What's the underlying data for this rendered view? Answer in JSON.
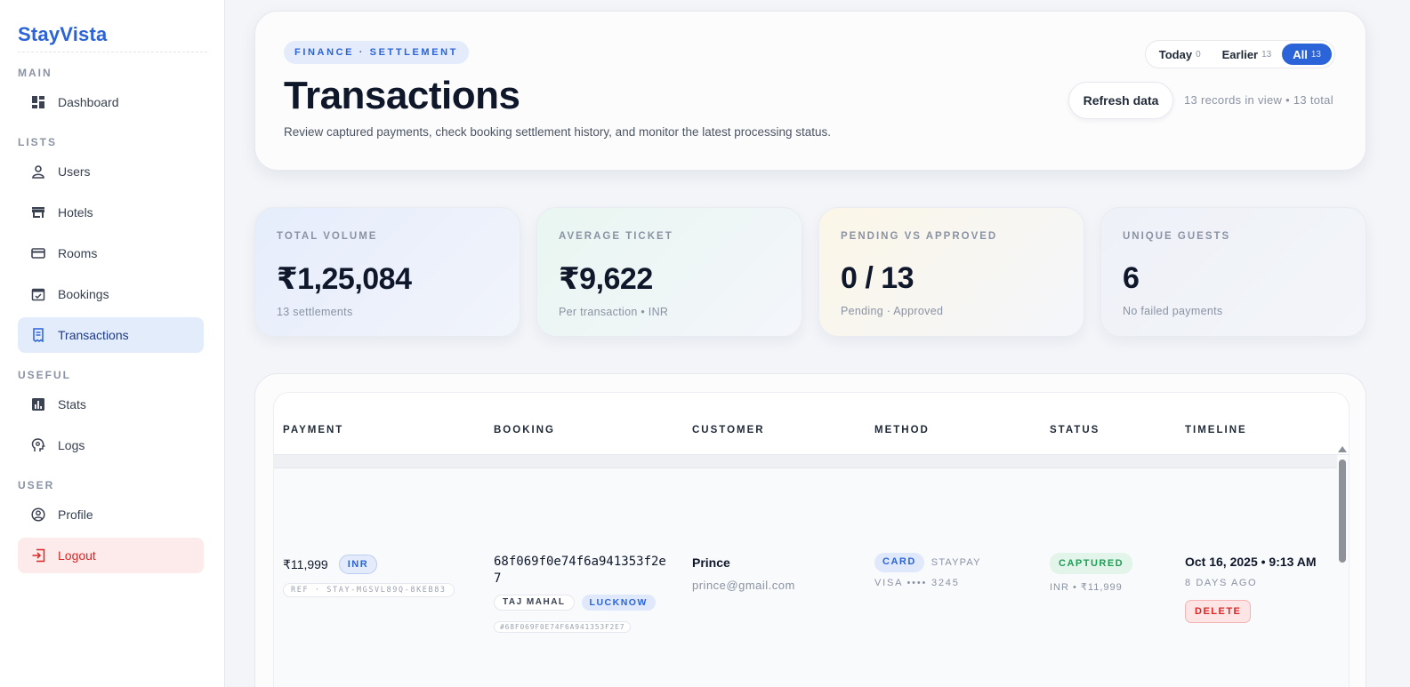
{
  "app": {
    "name": "StayVista"
  },
  "sidebar": {
    "sections": [
      {
        "title": "MAIN",
        "items": [
          {
            "label": "Dashboard",
            "icon": "dashboard-icon"
          }
        ]
      },
      {
        "title": "LISTS",
        "items": [
          {
            "label": "Users",
            "icon": "user-icon"
          },
          {
            "label": "Hotels",
            "icon": "store-icon"
          },
          {
            "label": "Rooms",
            "icon": "credit-card-icon"
          },
          {
            "label": "Bookings",
            "icon": "calendar-check-icon"
          },
          {
            "label": "Transactions",
            "icon": "receipt-icon",
            "active": true
          }
        ]
      },
      {
        "title": "USEFUL",
        "items": [
          {
            "label": "Stats",
            "icon": "bar-chart-icon"
          },
          {
            "label": "Logs",
            "icon": "psychology-icon"
          }
        ]
      },
      {
        "title": "USER",
        "items": [
          {
            "label": "Profile",
            "icon": "account-circle-icon"
          },
          {
            "label": "Logout",
            "icon": "logout-icon"
          }
        ]
      }
    ]
  },
  "header": {
    "eyebrow": "FINANCE · SETTLEMENT",
    "title": "Transactions",
    "subtitle": "Review captured payments, check booking settlement history, and monitor the latest processing status.",
    "filters": [
      {
        "label": "Today",
        "count": "0"
      },
      {
        "label": "Earlier",
        "count": "13"
      },
      {
        "label": "All",
        "count": "13",
        "active": true
      }
    ],
    "refresh_label": "Refresh data",
    "records_text": "13 records in view • 13 total"
  },
  "stats": [
    {
      "label": "TOTAL VOLUME",
      "value": "₹1,25,084",
      "sub": "13 settlements"
    },
    {
      "label": "AVERAGE TICKET",
      "value": "₹9,622",
      "sub": "Per transaction • INR"
    },
    {
      "label": "PENDING VS APPROVED",
      "value": "0 / 13",
      "sub": "Pending · Approved"
    },
    {
      "label": "UNIQUE GUESTS",
      "value": "6",
      "sub": "No failed payments"
    }
  ],
  "table": {
    "columns": [
      "PAYMENT",
      "BOOKING",
      "CUSTOMER",
      "METHOD",
      "STATUS",
      "TIMELINE"
    ],
    "rows": [
      {
        "amount": "₹11,999",
        "currency": "INR",
        "ref": "REF · STAY-MGSVL89Q-8KEB83",
        "booking_id": "68f069f0e74f6a941353f2e7",
        "hotel": "TAJ MAHAL",
        "city": "LUCKNOW",
        "booking_hash": "#68F069F0E74F6A941353F2E7",
        "customer_name": "Prince",
        "customer_email": "prince@gmail.com",
        "method": "CARD",
        "gateway": "STAYPAY",
        "card": "VISA •••• 3245",
        "status": "CAPTURED",
        "status_sub": "INR • ₹11,999",
        "time": "Oct 16, 2025 • 9:13 AM",
        "ago": "8 DAYS AGO",
        "delete_label": "DELETE"
      }
    ]
  },
  "colors": {
    "accent": "#2b63d9",
    "danger": "#dc2626",
    "success": "#1f9d55"
  }
}
